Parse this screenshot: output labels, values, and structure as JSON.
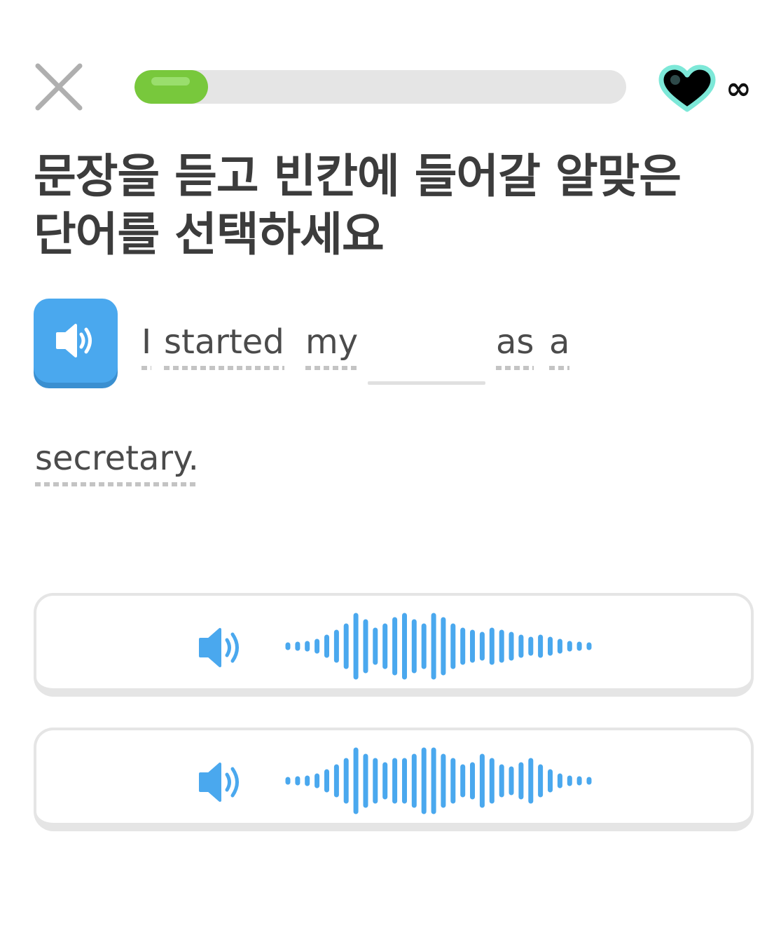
{
  "header": {
    "close_icon": "close-icon",
    "progress_fraction": 0.15,
    "hearts_icon": "heart-icon",
    "hearts_count": "∞",
    "colors": {
      "progress": "#78c83c",
      "track": "#e5e5e5"
    }
  },
  "prompt": {
    "title_line1": "문장을 듣고 빈칸에 들어갈 알맞은",
    "title_line2": "단어를 선택하세요"
  },
  "sentence": {
    "speaker_icon": "speaker-icon",
    "word_1": "I",
    "word_2": "started",
    "word_3": "my",
    "word_4": "as",
    "word_5": "a",
    "word_6": "secretary."
  },
  "options": [
    {
      "icon": "speaker-icon",
      "waveform": "audio-waveform"
    },
    {
      "icon": "speaker-icon",
      "waveform": "audio-waveform"
    }
  ],
  "colors": {
    "accent": "#4aa8ee",
    "text": "#4b4b4b"
  }
}
